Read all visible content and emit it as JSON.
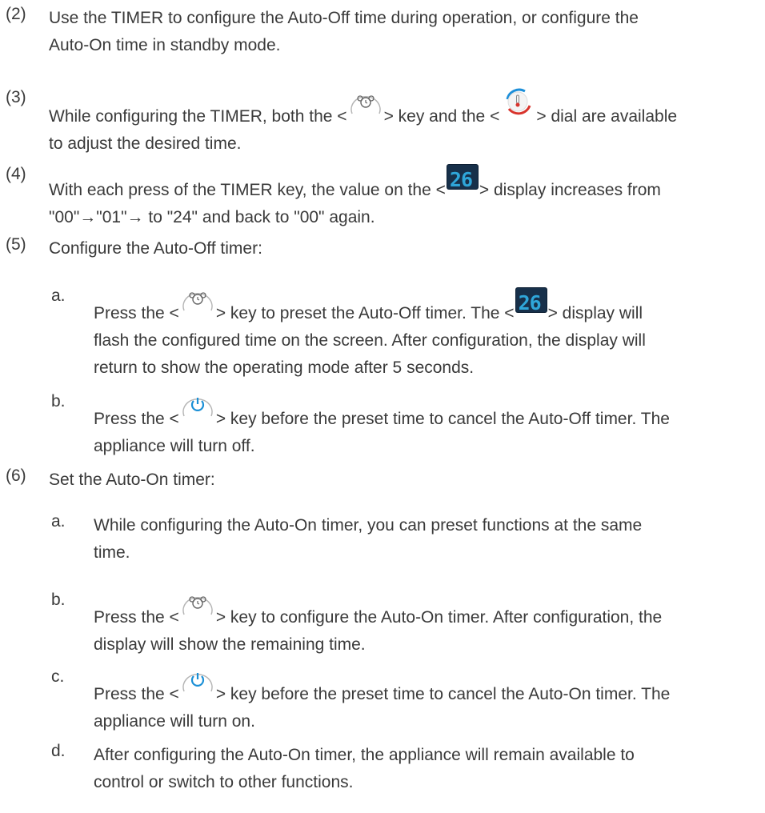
{
  "items": [
    {
      "num": "(2)",
      "l1": "Use the TIMER to configure the Auto-Off time during operation, or configure the",
      "l2": "Auto-On time in standby mode."
    },
    {
      "num": "(3)",
      "l1a": "While configuring the TIMER, both the <",
      "l1b": "> key and the <",
      "l1c": "> dial are available",
      "l2": "to adjust the desired time."
    },
    {
      "num": "(4)",
      "l1a": "With each press of the TIMER key, the value on the <",
      "l1b": "> display increases from",
      "l2": "\"00\"→\"01\"→ to \"24\" and back to \"00\" again."
    },
    {
      "num": "(5)",
      "l1": "Configure the Auto-Off timer:"
    },
    {
      "num": "(6)",
      "l1": "Set the Auto-On timer:"
    }
  ],
  "sub5": [
    {
      "num": "a.",
      "l1a": "Press the <",
      "l1b": "> key to preset the Auto-Off timer. The <",
      "l1c": "> display will",
      "l2": "flash the configured time on the screen. After configuration, the display will",
      "l3": "return to show the operating mode after 5 seconds."
    },
    {
      "num": "b.",
      "l1a": "Press the <",
      "l1b": "> key before the preset time to cancel the Auto-Off timer. The",
      "l2": "appliance will turn off."
    }
  ],
  "sub6": [
    {
      "num": "a.",
      "l1": "While configuring the Auto-On timer, you can preset functions at the same",
      "l2": "time."
    },
    {
      "num": "b.",
      "l1a": "Press the <",
      "l1b": "> key to configure the Auto-On timer. After configuration, the",
      "l2": "display will show the remaining time."
    },
    {
      "num": "c.",
      "l1a": "Press the <",
      "l1b": "> key before the preset time to cancel the Auto-On timer. The",
      "l2": "appliance will turn on."
    },
    {
      "num": "d.",
      "l1": "After configuring the Auto-On timer, the appliance will remain available to",
      "l2": "control or switch to other functions."
    }
  ],
  "lcd_value": "26",
  "icons": {
    "timer": "alarm-clock-icon",
    "dial": "thermometer-dial-icon",
    "power": "power-icon",
    "display": "lcd-display-icon"
  },
  "colors": {
    "text": "#3a3a3a",
    "lcd_bg": "#17304a",
    "lcd_digits": "#2fa6d9",
    "power_blue": "#1a8fd6",
    "dial_red": "#d8332c",
    "dial_blue": "#1d8fd9"
  }
}
